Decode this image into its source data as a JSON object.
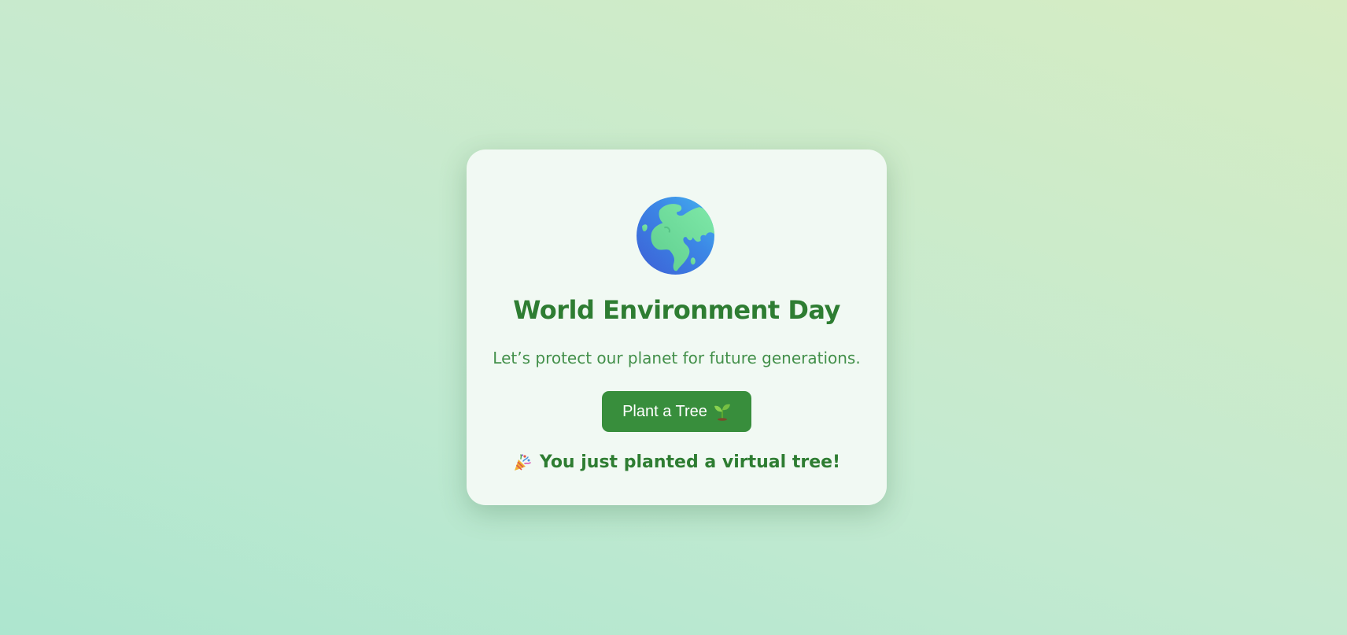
{
  "card": {
    "title": "World Environment Day",
    "subtitle": "Let’s protect our planet for future generations.",
    "globe_icon": "globe-europe-africa-icon",
    "button": {
      "label": "Plant a Tree",
      "icon": "seedling-icon",
      "color": "#388e3c"
    },
    "message": {
      "icon": "party-popper-icon",
      "text": "You just planted a virtual tree!"
    }
  },
  "colors": {
    "accent": "#2e7d32",
    "card_background": "#f1f9f3"
  }
}
